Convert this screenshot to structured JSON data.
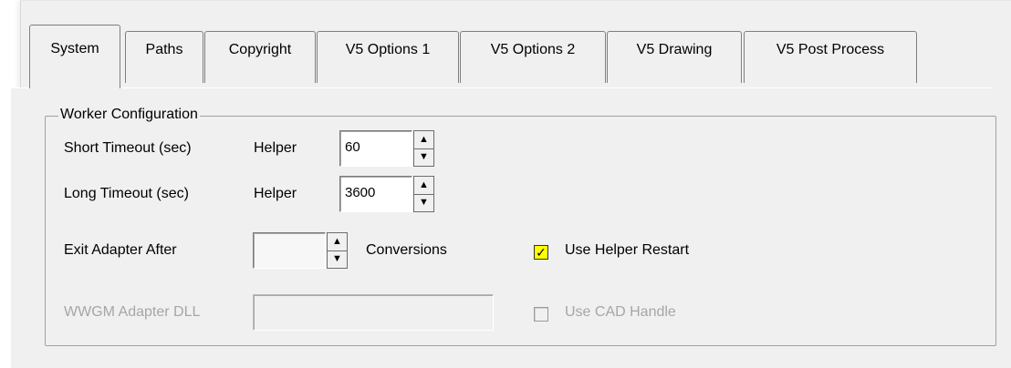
{
  "tabs": [
    {
      "label": "System",
      "active": true
    },
    {
      "label": "Paths",
      "active": false
    },
    {
      "label": "Copyright",
      "active": false
    },
    {
      "label": "V5 Options 1",
      "active": false
    },
    {
      "label": "V5 Options 2",
      "active": false
    },
    {
      "label": "V5 Drawing",
      "active": false
    },
    {
      "label": "V5 Post Process",
      "active": false
    }
  ],
  "group": {
    "title": "Worker Configuration"
  },
  "short_timeout": {
    "label": "Short Timeout (sec)",
    "helper_label": "Helper",
    "value": "60"
  },
  "long_timeout": {
    "label": "Long Timeout (sec)",
    "helper_label": "Helper",
    "value": "3600"
  },
  "exit_adapter": {
    "label": "Exit Adapter After",
    "value": "",
    "suffix": "Conversions"
  },
  "use_helper_restart": {
    "label": "Use Helper Restart",
    "checked": true,
    "check_color": "#ffff00"
  },
  "wwgm_adapter": {
    "label": "WWGM Adapter DLL",
    "value": ""
  },
  "use_cad_handle": {
    "label": "Use CAD Handle",
    "checked": false,
    "enabled": false
  },
  "icons": {
    "spin_up": "up-arrow-icon",
    "spin_down": "down-arrow-icon",
    "check": "check-icon"
  }
}
